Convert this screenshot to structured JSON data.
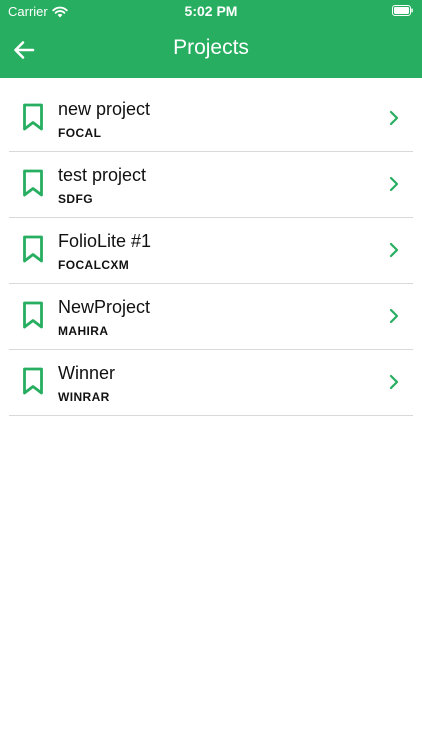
{
  "status_bar": {
    "carrier": "Carrier",
    "time": "5:02 PM",
    "wifi_icon": "wifi-icon",
    "battery_icon": "battery-icon"
  },
  "nav": {
    "title": "Projects",
    "back_icon": "arrow-left-icon"
  },
  "colors": {
    "accent": "#27ae60",
    "divider": "#d9d9d9",
    "text": "#111111"
  },
  "projects": [
    {
      "title": "new project",
      "code": "FOCAL",
      "icon": "bookmark-icon",
      "trailing_icon": "chevron-right-icon"
    },
    {
      "title": "test project",
      "code": "SDFG",
      "icon": "bookmark-icon",
      "trailing_icon": "chevron-right-icon"
    },
    {
      "title": "FolioLite #1",
      "code": "FOCALCXM",
      "icon": "bookmark-icon",
      "trailing_icon": "chevron-right-icon"
    },
    {
      "title": "NewProject",
      "code": "MAHIRA",
      "icon": "bookmark-icon",
      "trailing_icon": "chevron-right-icon"
    },
    {
      "title": "Winner",
      "code": "WINRAR",
      "icon": "bookmark-icon",
      "trailing_icon": "chevron-right-icon"
    }
  ]
}
